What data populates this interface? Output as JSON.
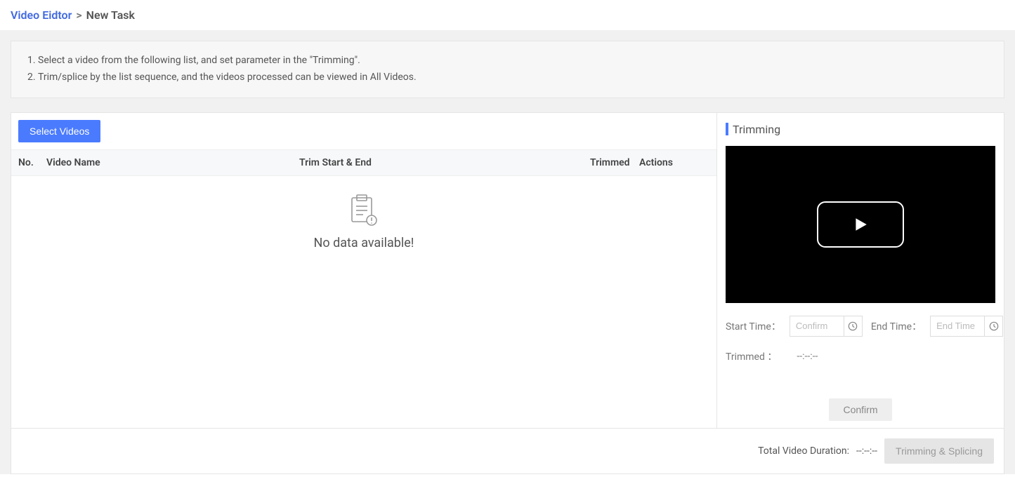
{
  "breadcrumb": {
    "link": "Video Eidtor",
    "sep": ">",
    "current": "New Task"
  },
  "instructions": {
    "items": [
      "Select a video from the following list, and set parameter in the \"Trimming\".",
      "Trim/splice by the list sequence, and the videos processed can be viewed in All Videos."
    ]
  },
  "toolbar": {
    "select_videos_label": "Select Videos"
  },
  "table": {
    "columns": {
      "no": "No.",
      "name": "Video Name",
      "trim": "Trim Start & End",
      "trimmed": "Trimmed",
      "actions": "Actions"
    },
    "empty_text": "No data available!"
  },
  "trimming": {
    "title": "Trimming",
    "start_label": "Start Time：",
    "start_placeholder": "Confirm",
    "end_label": "End Time：",
    "end_placeholder": "End Time",
    "trimmed_label": "Trimmed ：",
    "trimmed_value": "--:--:--",
    "confirm_label": "Confirm"
  },
  "footer": {
    "total_label": "Total Video Duration: ",
    "total_value": "--:--:--",
    "action_label": "Trimming & Splicing"
  }
}
